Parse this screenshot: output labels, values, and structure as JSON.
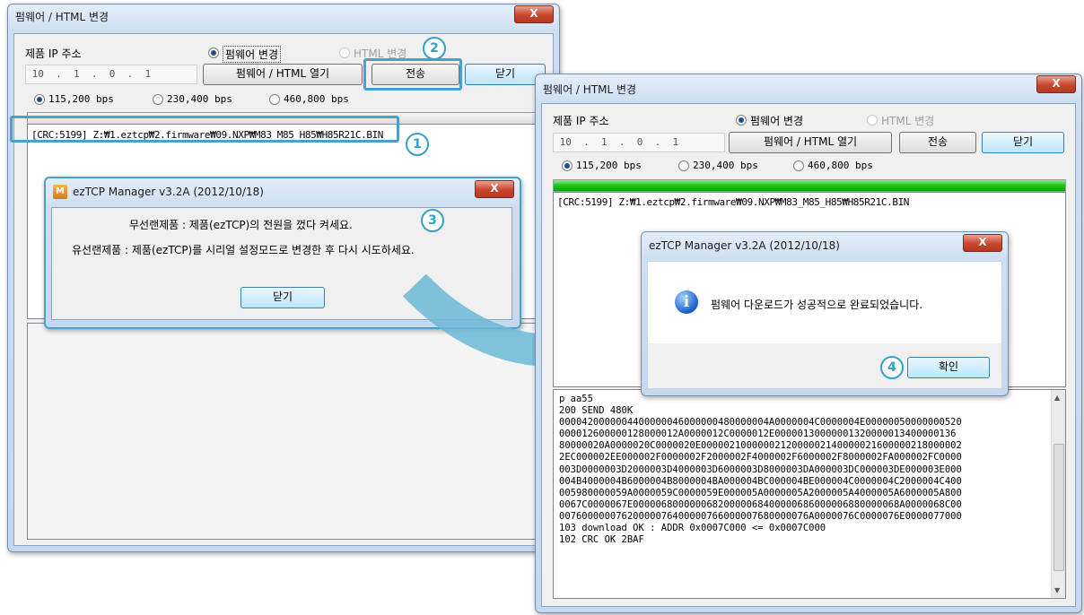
{
  "window_left": {
    "title": "펌웨어 / HTML 변경",
    "close": "X",
    "ip_label": "제품 IP 주소",
    "ip_value": " 10  .  1  .  0  .  1",
    "radio_firmware": "펌웨어 변경",
    "radio_html": "HTML 변경",
    "open_button": "펌웨어 / HTML 열기",
    "send_button": "전송",
    "close_button": "닫기",
    "baud_115": "115,200 bps",
    "baud_230": "230,400 bps",
    "baud_460": "460,800 bps",
    "file_path": "[CRC:5199] Z:₩1.eztcp₩2.firmware₩09.NXP₩M83_M85_H85₩H85R21C.BIN"
  },
  "dialog_left": {
    "title": "ezTCP Manager v3.2A (2012/10/18)",
    "close": "X",
    "line1": "무선랜제품 : 제품(ezTCP)의 전원을 껐다 켜세요.",
    "line2": "유선랜제품 : 제품(ezTCP)를 시리얼 설정모드로 변경한 후 다시 시도하세요.",
    "button": "닫기"
  },
  "window_right": {
    "title": "펌웨어 / HTML 변경",
    "close": "X",
    "ip_label": "제품 IP 주소",
    "ip_value": " 10  .  1  .  0  .  1",
    "radio_firmware": "펌웨어 변경",
    "radio_html": "HTML 변경",
    "open_button": "펌웨어 / HTML 열기",
    "send_button": "전송",
    "close_button": "닫기",
    "baud_115": "115,200 bps",
    "baud_230": "230,400 bps",
    "baud_460": "460,800 bps",
    "progress": 1.0,
    "file_path": "[CRC:5199] Z:₩1.eztcp₩2.firmware₩09.NXP₩M83_M85_H85₩H85R21C.BIN",
    "log": [
      "p aa55",
      "200 SEND 480K",
      "0000420000004400000046000000480000004A0000004C0000004E00000050000000520",
      "000012600000128000012A0000012C0000012E00000130000001320000013400000136",
      "80000020A0000020C0000020E0000021000000212000002140000021600000218000002",
      "2EC000002EE000002F0000002F2000002F4000002F6000002F8000002FA000002FC0000",
      "003D0000003D2000003D4000003D6000003D8000003DA000003DC000003DE000003E000",
      "004B4000004B6000004B8000004BA000004BC000004BE000004C0000004C2000004C400",
      "005980000059A0000059C0000059E000005A0000005A2000005A4000005A6000005A800",
      "0067C0000067E00000680000006820000068400000686000006880000068A0000068C00",
      "00760000007620000076400000766000007680000076A0000076C0000076E0000077000",
      "103 download OK : ADDR 0x0007C000 <= 0x0007C000",
      "102 CRC OK 2BAF"
    ]
  },
  "dialog_right": {
    "title": "ezTCP Manager v3.2A (2012/10/18)",
    "close": "X",
    "message": "펌웨어 다운로드가 성공적으로 완료되었습니다.",
    "button": "확인"
  },
  "callouts": {
    "n1": "1",
    "n2": "2",
    "n3": "3",
    "n4": "4"
  },
  "colors": {
    "accent": "#4aa0c8",
    "progress": "#19c319"
  }
}
